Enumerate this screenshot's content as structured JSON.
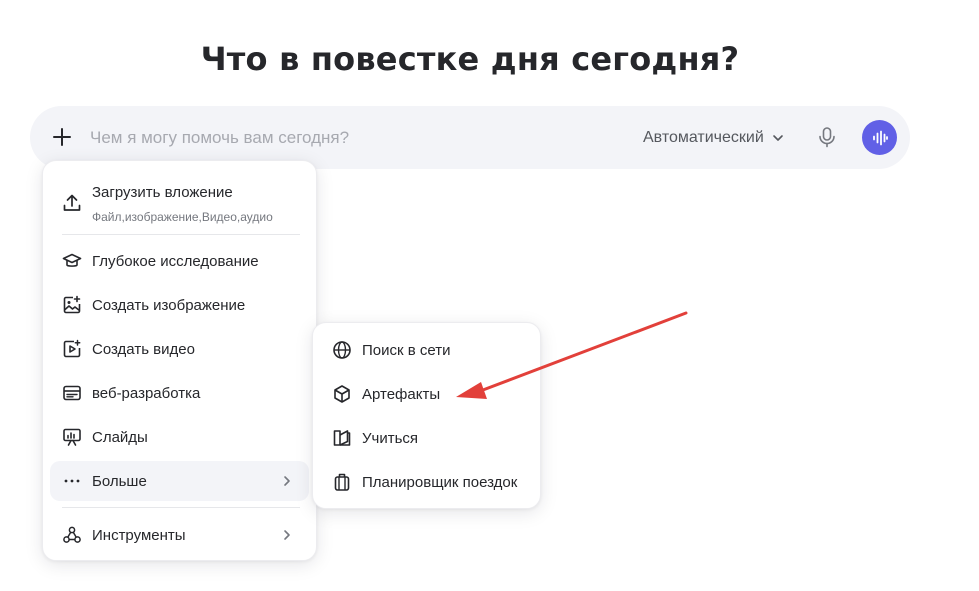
{
  "page": {
    "title": "Что в повестке дня сегодня?"
  },
  "composer": {
    "placeholder": "Чем я могу помочь вам сегодня?",
    "model": "Автоматический",
    "icons": {
      "plus": "plus-icon",
      "mic": "microphone-icon",
      "voice": "voice-wave-icon",
      "model_chevron": "chevron-down-icon"
    },
    "colors": {
      "background": "#f3f4f8",
      "voice_button": "#6160e6"
    }
  },
  "menu": {
    "upload": {
      "label": "Загрузить вложение",
      "description": "Файл,изображение,Видео,аудио",
      "icon": "upload-icon"
    },
    "items": [
      {
        "label": "Глубокое исследование",
        "icon": "graduation-cap-icon"
      },
      {
        "label": "Создать изображение",
        "icon": "image-plus-icon"
      },
      {
        "label": "Создать видео",
        "icon": "video-play-icon"
      },
      {
        "label": "веб-разработка",
        "icon": "browser-window-icon"
      },
      {
        "label": "Слайды",
        "icon": "presentation-icon"
      },
      {
        "label": "Больше",
        "icon": "more-dots-icon",
        "has_submenu": true,
        "highlighted": true
      }
    ],
    "tools": {
      "label": "Инструменты",
      "icon": "tools-icon",
      "has_submenu": true
    }
  },
  "submenu": {
    "items": [
      {
        "label": "Поиск в сети",
        "icon": "globe-icon"
      },
      {
        "label": "Артефакты",
        "icon": "cube-icon"
      },
      {
        "label": "Учиться",
        "icon": "book-icon"
      },
      {
        "label": "Планировщик поездок",
        "icon": "suitcase-icon"
      }
    ]
  },
  "annotation": {
    "type": "arrow",
    "color": "#e2403a",
    "points_to": "Артефакты"
  }
}
